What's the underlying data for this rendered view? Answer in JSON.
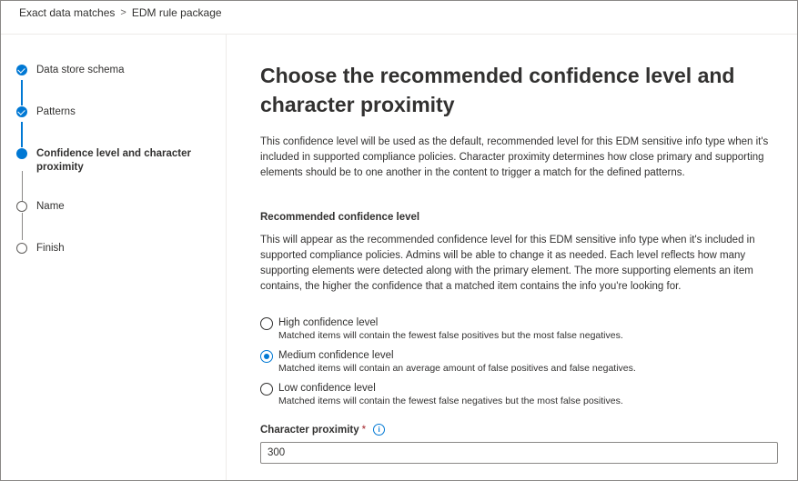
{
  "breadcrumb": {
    "items": [
      "Exact data matches",
      "EDM rule package"
    ],
    "separator": ">"
  },
  "steps": [
    {
      "label": "Data store schema",
      "state": "done"
    },
    {
      "label": "Patterns",
      "state": "done"
    },
    {
      "label": "Confidence level and character proximity",
      "state": "current"
    },
    {
      "label": "Name",
      "state": "todo"
    },
    {
      "label": "Finish",
      "state": "todo"
    }
  ],
  "main": {
    "title": "Choose the recommended confidence level and character proximity",
    "intro": "This confidence level will be used as the default, recommended level for this EDM sensitive info type when it's included in supported compliance policies. Character proximity determines how close primary and supporting elements should be to one another in the content to trigger a match for the defined patterns.",
    "confidence_heading": "Recommended confidence level",
    "confidence_desc": "This will appear as the recommended confidence level for this EDM sensitive info type when it's included in supported compliance policies. Admins will be able to change it as needed. Each level reflects how many supporting elements were detected along with the primary element. The more supporting elements an item contains, the higher the confidence that a matched item contains the info you're looking for.",
    "options": [
      {
        "title": "High confidence level",
        "desc": "Matched items will contain the fewest false positives but the most false negatives.",
        "checked": false
      },
      {
        "title": "Medium confidence level",
        "desc": "Matched items will contain an average amount of false positives and false negatives.",
        "checked": true
      },
      {
        "title": "Low confidence level",
        "desc": "Matched items will contain the fewest false negatives but the most false positives.",
        "checked": false
      }
    ],
    "proximity_label": "Character proximity",
    "required_mark": "*",
    "info_glyph": "i",
    "proximity_value": "300"
  },
  "colors": {
    "accent": "#0078d4",
    "required": "#a4262c"
  }
}
